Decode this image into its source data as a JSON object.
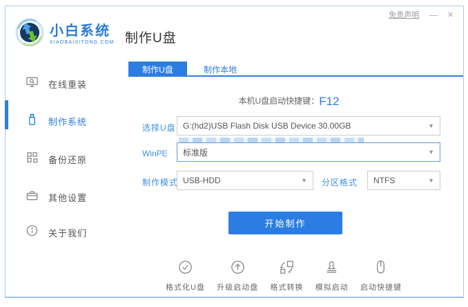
{
  "window": {
    "disclaimer": "免责声明",
    "minimize": "—",
    "close": "×"
  },
  "brand": {
    "name": "小白系统",
    "domain": "XIAOBAIXITONG.COM"
  },
  "page_title": "制作U盘",
  "sidebar": {
    "items": [
      {
        "label": "在线重装",
        "icon": "monitor-reinstall-icon",
        "active": false
      },
      {
        "label": "制作系统",
        "icon": "usb-drive-icon",
        "active": true
      },
      {
        "label": "备份还原",
        "icon": "backup-grid-icon",
        "active": false
      },
      {
        "label": "其他设置",
        "icon": "briefcase-icon",
        "active": false
      },
      {
        "label": "关于我们",
        "icon": "info-circle-icon",
        "active": false
      }
    ]
  },
  "tabs": [
    {
      "label": "制作U盘",
      "active": true
    },
    {
      "label": "制作本地",
      "active": false
    }
  ],
  "hotkey": {
    "prefix": "本机U盘启动快捷键：",
    "key": "F12"
  },
  "form": {
    "usb_label": "选择U盘",
    "usb_value": "G:(hd2)USB Flash Disk USB Device 30.00GB",
    "winpe_label": "WinPE",
    "winpe_value": "标准版",
    "mode_label": "制作模式",
    "mode_value": "USB-HDD",
    "partition_label": "分区格式",
    "partition_value": "NTFS"
  },
  "start_button": "开始制作",
  "toolbar": {
    "items": [
      {
        "label": "格式化U盘",
        "icon": "check-circle-icon"
      },
      {
        "label": "升级启动盘",
        "icon": "arrow-up-circle-icon"
      },
      {
        "label": "格式转换",
        "icon": "format-convert-icon"
      },
      {
        "label": "模拟启动",
        "icon": "stamp-icon"
      },
      {
        "label": "启动快捷键",
        "icon": "mouse-icon"
      }
    ]
  },
  "colors": {
    "accent": "#2b7de1",
    "label_blue": "#3d8fe4",
    "window_border": "#aac9ef"
  }
}
